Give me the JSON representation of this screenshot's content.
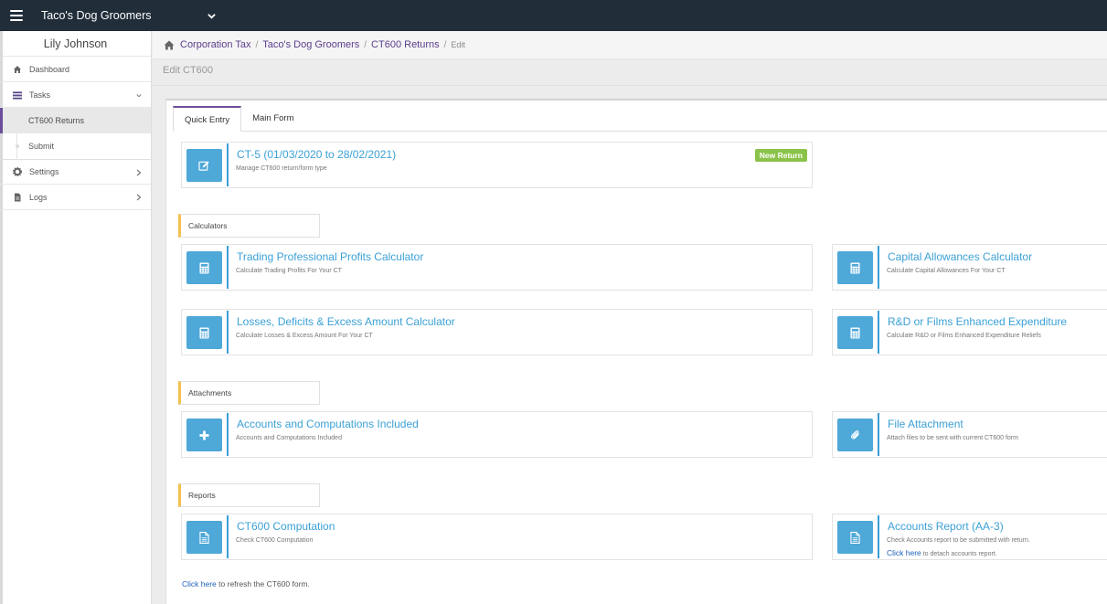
{
  "topbar": {
    "company": "Taco's Dog Groomers"
  },
  "sidebar": {
    "user": "Lily Johnson",
    "items": [
      {
        "label": "Dashboard"
      },
      {
        "label": "Tasks"
      },
      {
        "label": "Settings"
      },
      {
        "label": "Logs"
      }
    ],
    "task_subitems": [
      {
        "label": "CT600 Returns"
      },
      {
        "label": "Submit"
      }
    ]
  },
  "breadcrumb": {
    "items": [
      "Corporation Tax",
      "Taco's Dog Groomers",
      "CT600 Returns"
    ],
    "current": "Edit"
  },
  "page_title": "Edit CT600",
  "tabs": [
    {
      "label": "Quick Entry"
    },
    {
      "label": "Main Form"
    }
  ],
  "return_card": {
    "title": "CT-5 (01/03/2020 to 28/02/2021)",
    "subtitle": "Manage CT600 return/form type",
    "badge": "New Return"
  },
  "sections": {
    "calculators": "Calculators",
    "attachments": "Attachments",
    "reports": "Reports"
  },
  "cards": {
    "trading": {
      "title": "Trading Professional Profits Calculator",
      "subtitle": "Calculate Trading Profits For Your CT"
    },
    "capital": {
      "title": "Capital Allowances Calculator",
      "subtitle": "Calculate Capital Allowances For Your CT"
    },
    "losses": {
      "title": "Losses, Deficits & Excess Amount Calculator",
      "subtitle": "Calculate Losses & Excess Amount For Your CT"
    },
    "rnd": {
      "title": "R&D or Films Enhanced Expenditure",
      "subtitle": "Calculate R&D or Films Enhanced Expenditure Reliefs"
    },
    "accounts": {
      "title": "Accounts and Computations Included",
      "subtitle": "Accounts and Computations Included"
    },
    "file": {
      "title": "File Attachment",
      "subtitle": "Attach files to be sent with current CT600 form"
    },
    "computation": {
      "title": "CT600 Computation",
      "subtitle": "Check CT600 Computation"
    },
    "report": {
      "title": "Accounts Report (AA-3)",
      "subtitle": "Check Accounts report to be submitted with return.",
      "link": "Click here",
      "link_suffix": " to detach accounts report."
    }
  },
  "footer": {
    "link": "Click here",
    "suffix": " to refresh the CT600 form."
  },
  "colors": {
    "accent": "#6b4e9a",
    "icon_box": "#4ea8d8",
    "link": "#3ba0d6",
    "badge": "#8bc34a",
    "section_marker": "#f2c14e"
  }
}
